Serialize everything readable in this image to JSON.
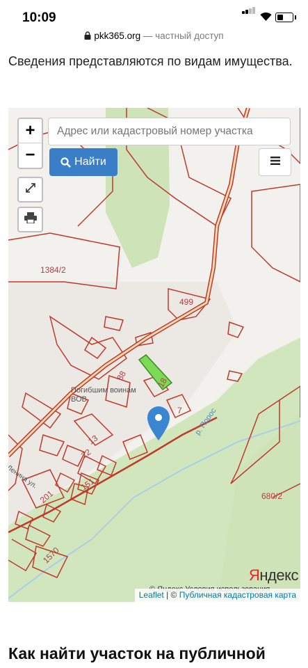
{
  "status_bar": {
    "time": "10:09"
  },
  "browser": {
    "domain": "pkk365.org",
    "suffix": " — частный доступ"
  },
  "intro_text": "Сведения представляются по видам имущества.",
  "map": {
    "zoom_in": "+",
    "zoom_out": "−",
    "search_placeholder": "Адрес или кадастровый номер участка",
    "find_button": "Найти",
    "parcel_labels": {
      "p1384": "1384/2",
      "p499": "499",
      "p88": "88",
      "p18": "18",
      "p7": "7",
      "p13": "13",
      "p22": "22",
      "p151": "151",
      "p201": "201",
      "p1570": "1570",
      "p680": "680/2"
    },
    "poi_label": "Погибшим воинам ВОВ",
    "river_label": "р. Порос",
    "street_label": "Ленина ул.",
    "yandex_logo_first": "Я",
    "yandex_logo_rest": "ндекс",
    "yandex_terms": "© Яндекс  Условия использования",
    "attribution": {
      "leaflet": "Leaflet",
      "separator": " | © ",
      "pkk": "Публичная кадастровая карта"
    }
  },
  "heading": "Как найти участок на публичной"
}
